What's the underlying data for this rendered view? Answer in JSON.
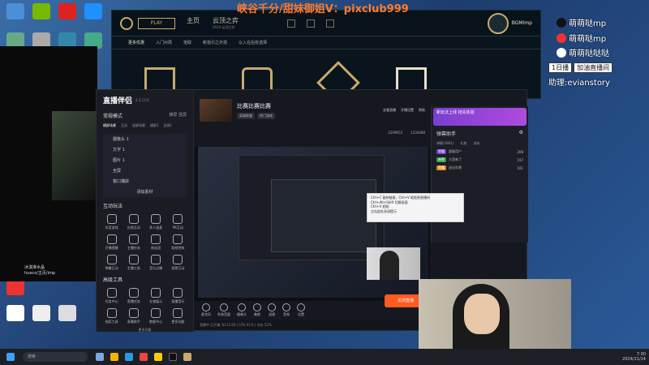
{
  "banner": "峡谷千分/甜妹御姐V：pixclub999",
  "social": [
    {
      "icon": "tiktok-icon",
      "label": "萌萌哒mp"
    },
    {
      "icon": "xiaohongshu-icon",
      "label": "萌萌哒mp"
    },
    {
      "icon": "weibo-icon",
      "label": "萌萌哒哒哒"
    }
  ],
  "pill": [
    "1日播",
    "加油直播间"
  ],
  "helper_text": "助理:evianstory",
  "league": {
    "play": "PLAY",
    "nav": [
      {
        "label": "主页",
        "sub": ""
      },
      {
        "label": "云顶之弈",
        "sub": "2024 云顶之弈"
      }
    ],
    "subnav": [
      "更多优惠",
      "入门对局",
      "拾取",
      "新指引之外观",
      "以入在后有选择"
    ],
    "profile_name": "BGMImp"
  },
  "app": {
    "title": "直播伴侣",
    "version": "4.3.13.0",
    "mode_label": "常规模式",
    "mode_right": [
      "横屏",
      "竖屏"
    ],
    "scene_tabs": [
      "横屏场景",
      "互动",
      "竖屏场景",
      "横屏1",
      "竖屏1"
    ],
    "scenes": [
      "摄像头 1",
      "文字 1",
      "图片 1",
      "全屏",
      "窗口捕获"
    ],
    "add_source": "添加素材",
    "interact_title": "互动玩法",
    "interact_tools": [
      "抖音游戏",
      "礼物互动",
      "多人连麦",
      "PK互动",
      "开播提醒",
      "主播任务",
      "粉丝团",
      "贴纸特效",
      "弹幕互动",
      "主播工具",
      "音乐点播",
      "投票互动"
    ],
    "tools_title": "高级工具",
    "tools": [
      "任务中心",
      "直播任务",
      "礼物展示",
      "直播音乐",
      "抽奖工具",
      "直播助手",
      "数据中心",
      "更多功能"
    ],
    "more": "更多功能",
    "stream_title": "比赛比赛比赛",
    "stream_tags": [
      "英雄联盟",
      "热门游戏"
    ],
    "top_right": [
      "去看直播",
      "开播设置",
      "帮助"
    ],
    "viewers": "2299653",
    "likes": "1234488",
    "controls": [
      "麦克风",
      "系统音量",
      "摄像头",
      "美颜",
      "滤镜",
      "音效",
      "设置"
    ],
    "start_button": "关闭直播",
    "status": "直播中 已开播 30:12:00 | CPU 41% | 内存 52%"
  },
  "danmu": {
    "promo": "新玩法上线 抢先体验",
    "header": "弹幕助手",
    "tabs": [
      "弹幕(3981)",
      "礼物",
      "进场"
    ],
    "rows": [
      {
        "badge": "荣耀",
        "text": "超级用户",
        "count": "208"
      },
      {
        "badge": "亲密",
        "text": "大哥来了",
        "count": "197"
      },
      {
        "badge": "荣耀",
        "text": "送出礼物",
        "count": "101"
      }
    ]
  },
  "context_menu": [
    "Ctrl+C 复制链接，Ctrl+V 粘贴到直播间",
    "Ctrl+Alt+Shift 切换画面",
    "Ctrl+V 粘贴",
    "点击此处关闭提示"
  ],
  "left_stream": {
    "name": "冰淇淋水晶",
    "sub": "hueco/主页/imp"
  },
  "taskbar": {
    "search": "搜索",
    "time": "7:30",
    "date": "2024/11/14"
  }
}
